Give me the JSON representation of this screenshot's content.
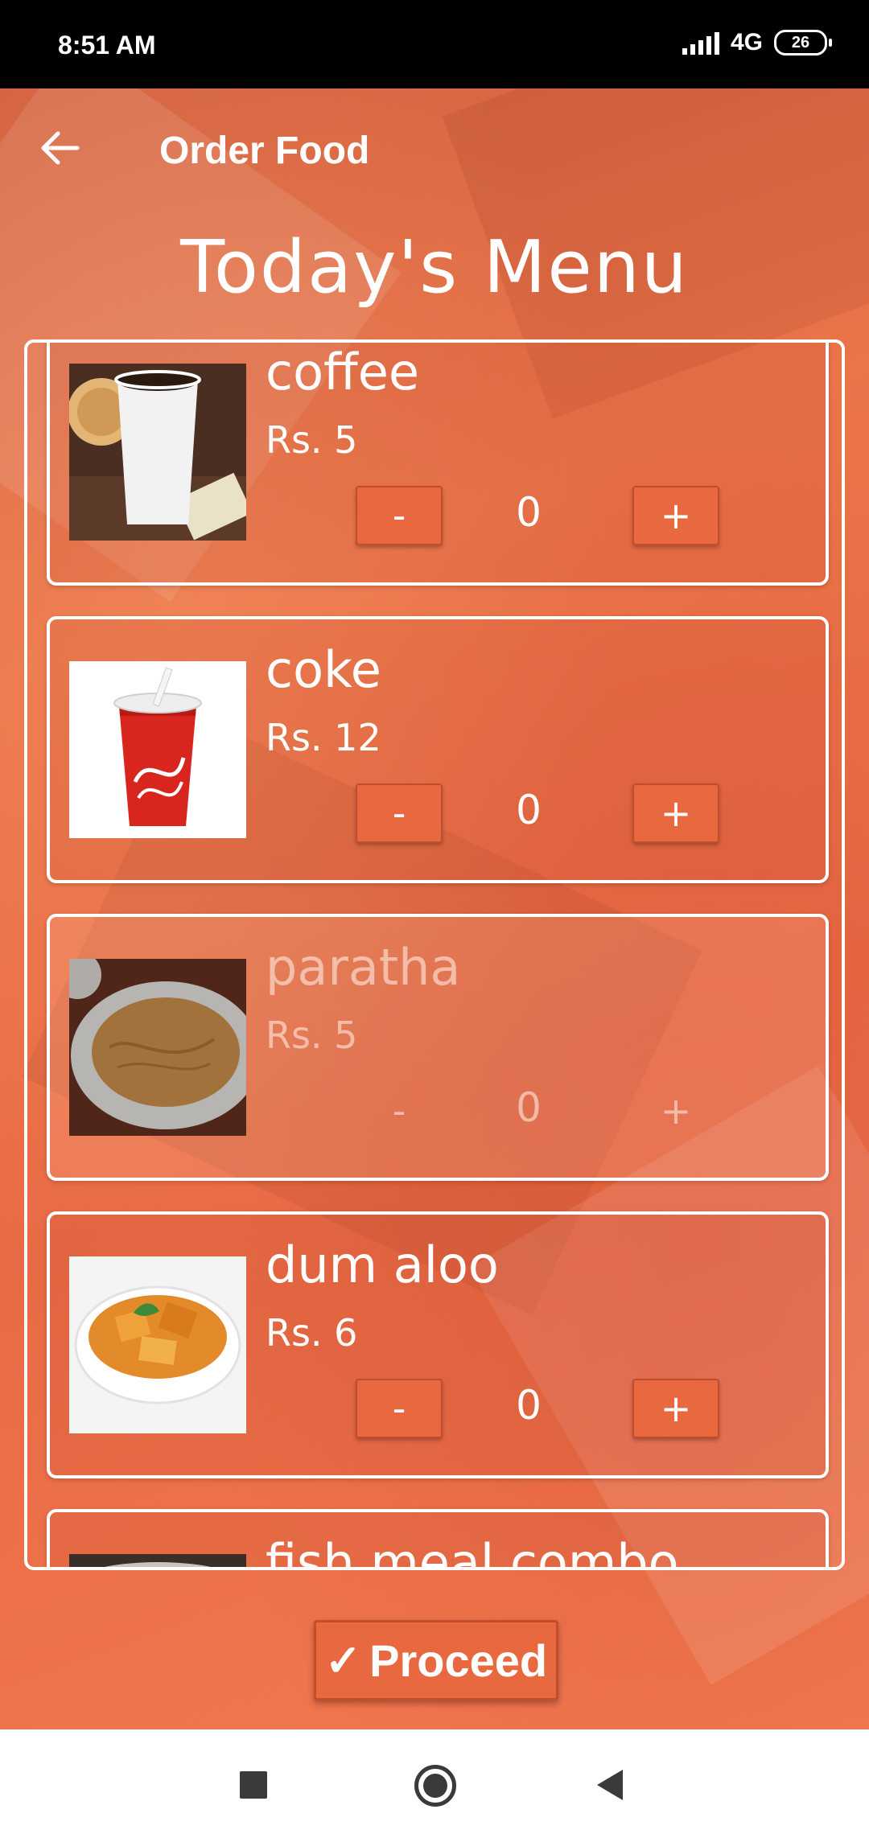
{
  "status_bar": {
    "time": "8:51 AM",
    "network": "4G",
    "battery": "26"
  },
  "toolbar": {
    "back_icon": "arrow-left-icon",
    "title": "Order Food"
  },
  "page": {
    "heading": "Today's Menu"
  },
  "menu": {
    "items": [
      {
        "name": "coffee",
        "price": "Rs. 5",
        "quantity": "0",
        "minus_label": "-",
        "plus_label": "+"
      },
      {
        "name": "coke",
        "price": "Rs. 12",
        "quantity": "0",
        "minus_label": "-",
        "plus_label": "+"
      },
      {
        "name": "paratha",
        "price": "Rs. 5",
        "quantity": "0",
        "minus_label": "-",
        "plus_label": "+"
      },
      {
        "name": "dum aloo",
        "price": "Rs. 6",
        "quantity": "0",
        "minus_label": "-",
        "plus_label": "+"
      },
      {
        "name": "fish meal combo"
      }
    ]
  },
  "actions": {
    "proceed_label": "Proceed",
    "proceed_icon": "check-icon"
  },
  "nav_bar": {
    "recent_icon": "square-icon",
    "home_icon": "circle-icon",
    "back_icon": "triangle-back-icon"
  },
  "colors": {
    "background": "#ec7048",
    "status_bar": "#000000",
    "nav_bar": "#ffffff",
    "accent": "#e8683f"
  }
}
